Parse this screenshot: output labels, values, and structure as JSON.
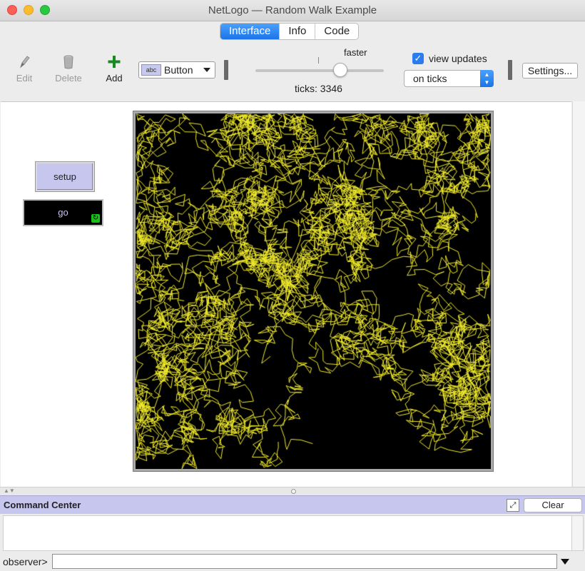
{
  "window": {
    "title": "NetLogo — Random Walk Example"
  },
  "tabs": [
    {
      "label": "Interface",
      "active": true
    },
    {
      "label": "Info",
      "active": false
    },
    {
      "label": "Code",
      "active": false
    }
  ],
  "toolbar": {
    "edit_label": "Edit",
    "delete_label": "Delete",
    "add_label": "Add",
    "widget_type": "Button",
    "widget_icon_text": "abc",
    "speed_label": "faster",
    "speed_fraction": 0.62,
    "ticks_label": "ticks: 3346",
    "view_updates_label": "view updates",
    "view_updates_checked": true,
    "update_mode": "on ticks",
    "settings_label": "Settings..."
  },
  "interface": {
    "setup_label": "setup",
    "go_label": "go",
    "world": {
      "background": "#000000",
      "trail_color": "#f0ea2c"
    }
  },
  "command_center": {
    "title": "Command Center",
    "clear_label": "Clear",
    "prompt_label": "observer>",
    "input_value": ""
  },
  "colors": {
    "accent_blue": "#1b74e8",
    "button_lavender": "#c7c6ee",
    "forever_green": "#18c018"
  }
}
